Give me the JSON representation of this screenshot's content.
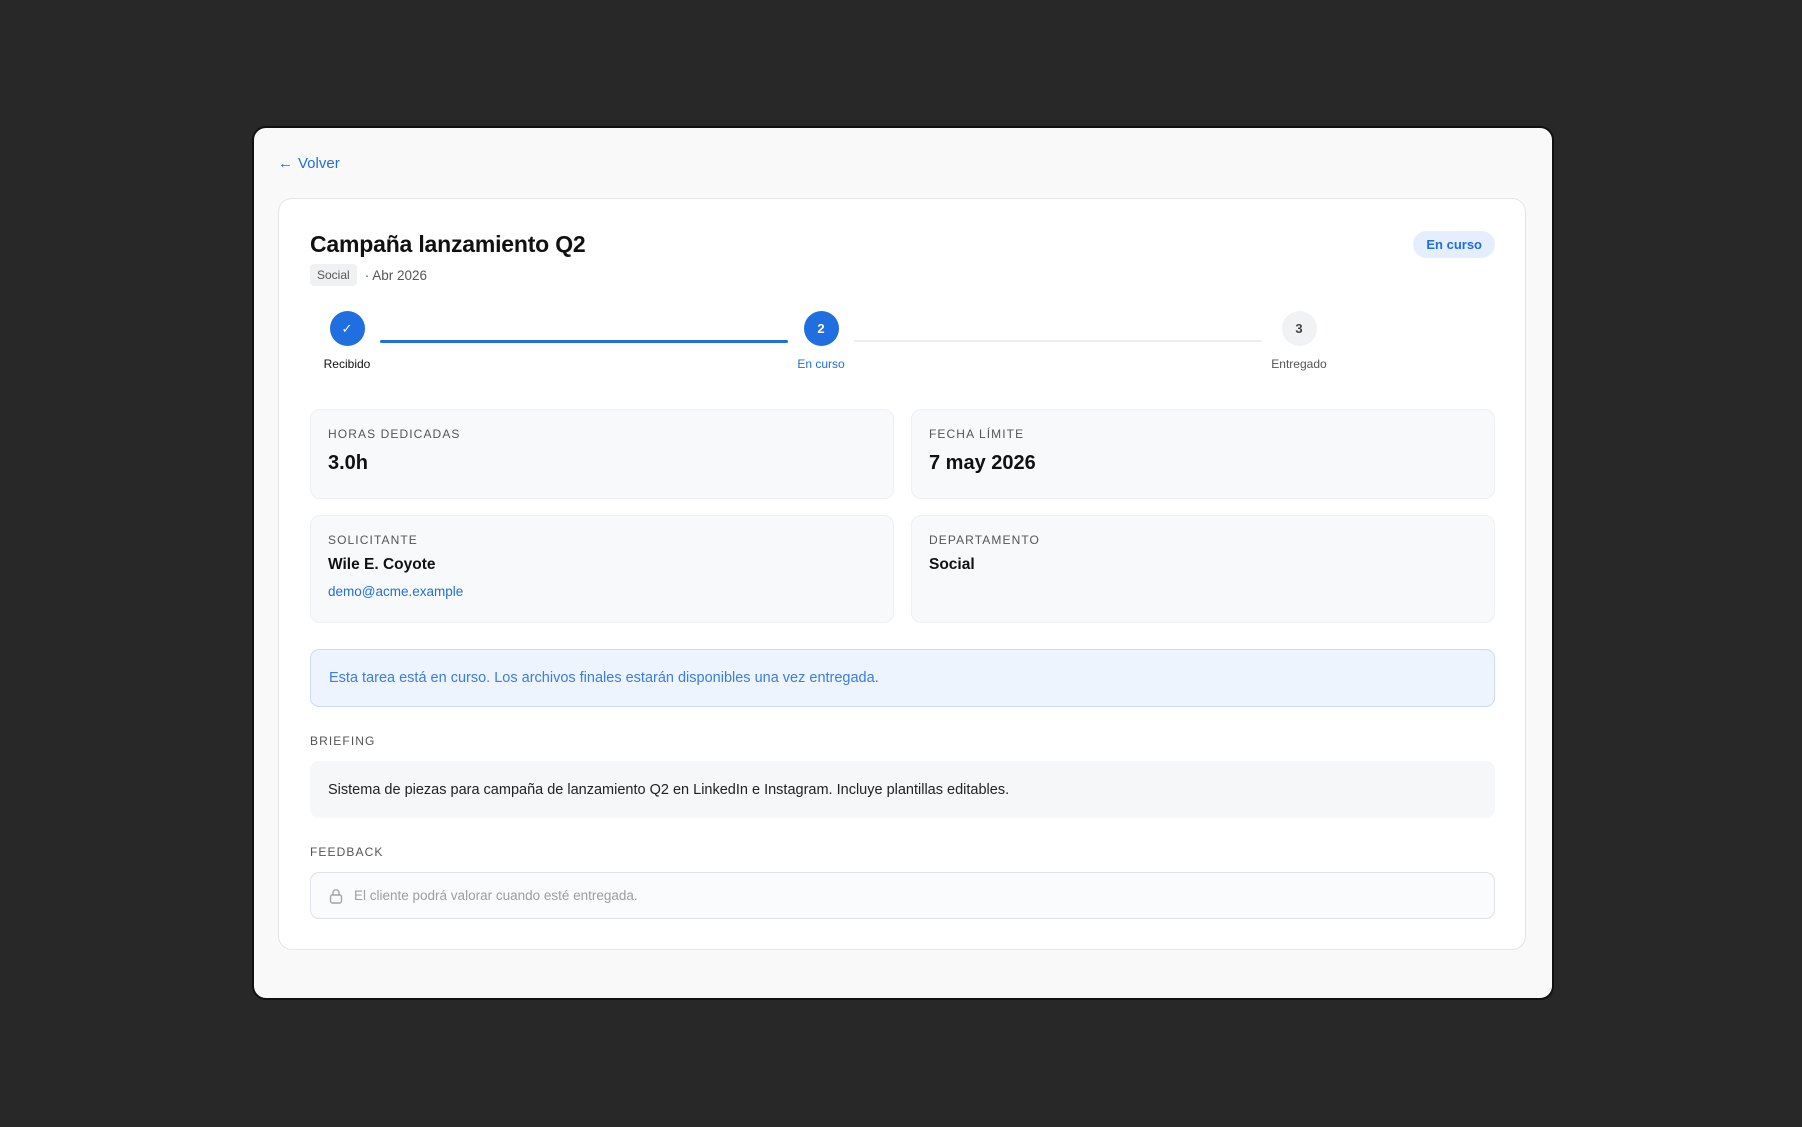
{
  "nav": {
    "back_arrow": "←",
    "back_label": "Volver"
  },
  "task": {
    "title": "Campaña lanzamiento Q2",
    "tag": "Social",
    "date": "· Abr 2026",
    "status": "En curso"
  },
  "stepper": {
    "steps": [
      {
        "number": "✓",
        "label": "Recibido",
        "state": "done"
      },
      {
        "number": "2",
        "label": "En curso",
        "state": "active"
      },
      {
        "number": "3",
        "label": "Entregado",
        "state": "pending"
      }
    ]
  },
  "details": {
    "hours": {
      "label": "HORAS DEDICADAS",
      "value": "3.0h"
    },
    "deadline": {
      "label": "FECHA LÍMITE",
      "value": "7 may 2026"
    },
    "requester": {
      "label": "SOLICITANTE",
      "name": "Wile E. Coyote",
      "email": "demo@acme.example"
    },
    "department": {
      "label": "DEPARTAMENTO",
      "value": "Social"
    }
  },
  "notice": "Esta tarea está en curso. Los archivos finales estarán disponibles una vez entregada.",
  "briefing": {
    "label": "BRIEFING",
    "text": "Sistema de piezas para campaña de lanzamiento Q2 en LinkedIn e Instagram. Incluye plantillas editables."
  },
  "feedback": {
    "label": "FEEDBACK",
    "placeholder": "El cliente podrá valorar cuando esté entregada."
  },
  "colors": {
    "accent": "#1f6fe0",
    "background": "#282828",
    "window": "#f9f9fa"
  }
}
